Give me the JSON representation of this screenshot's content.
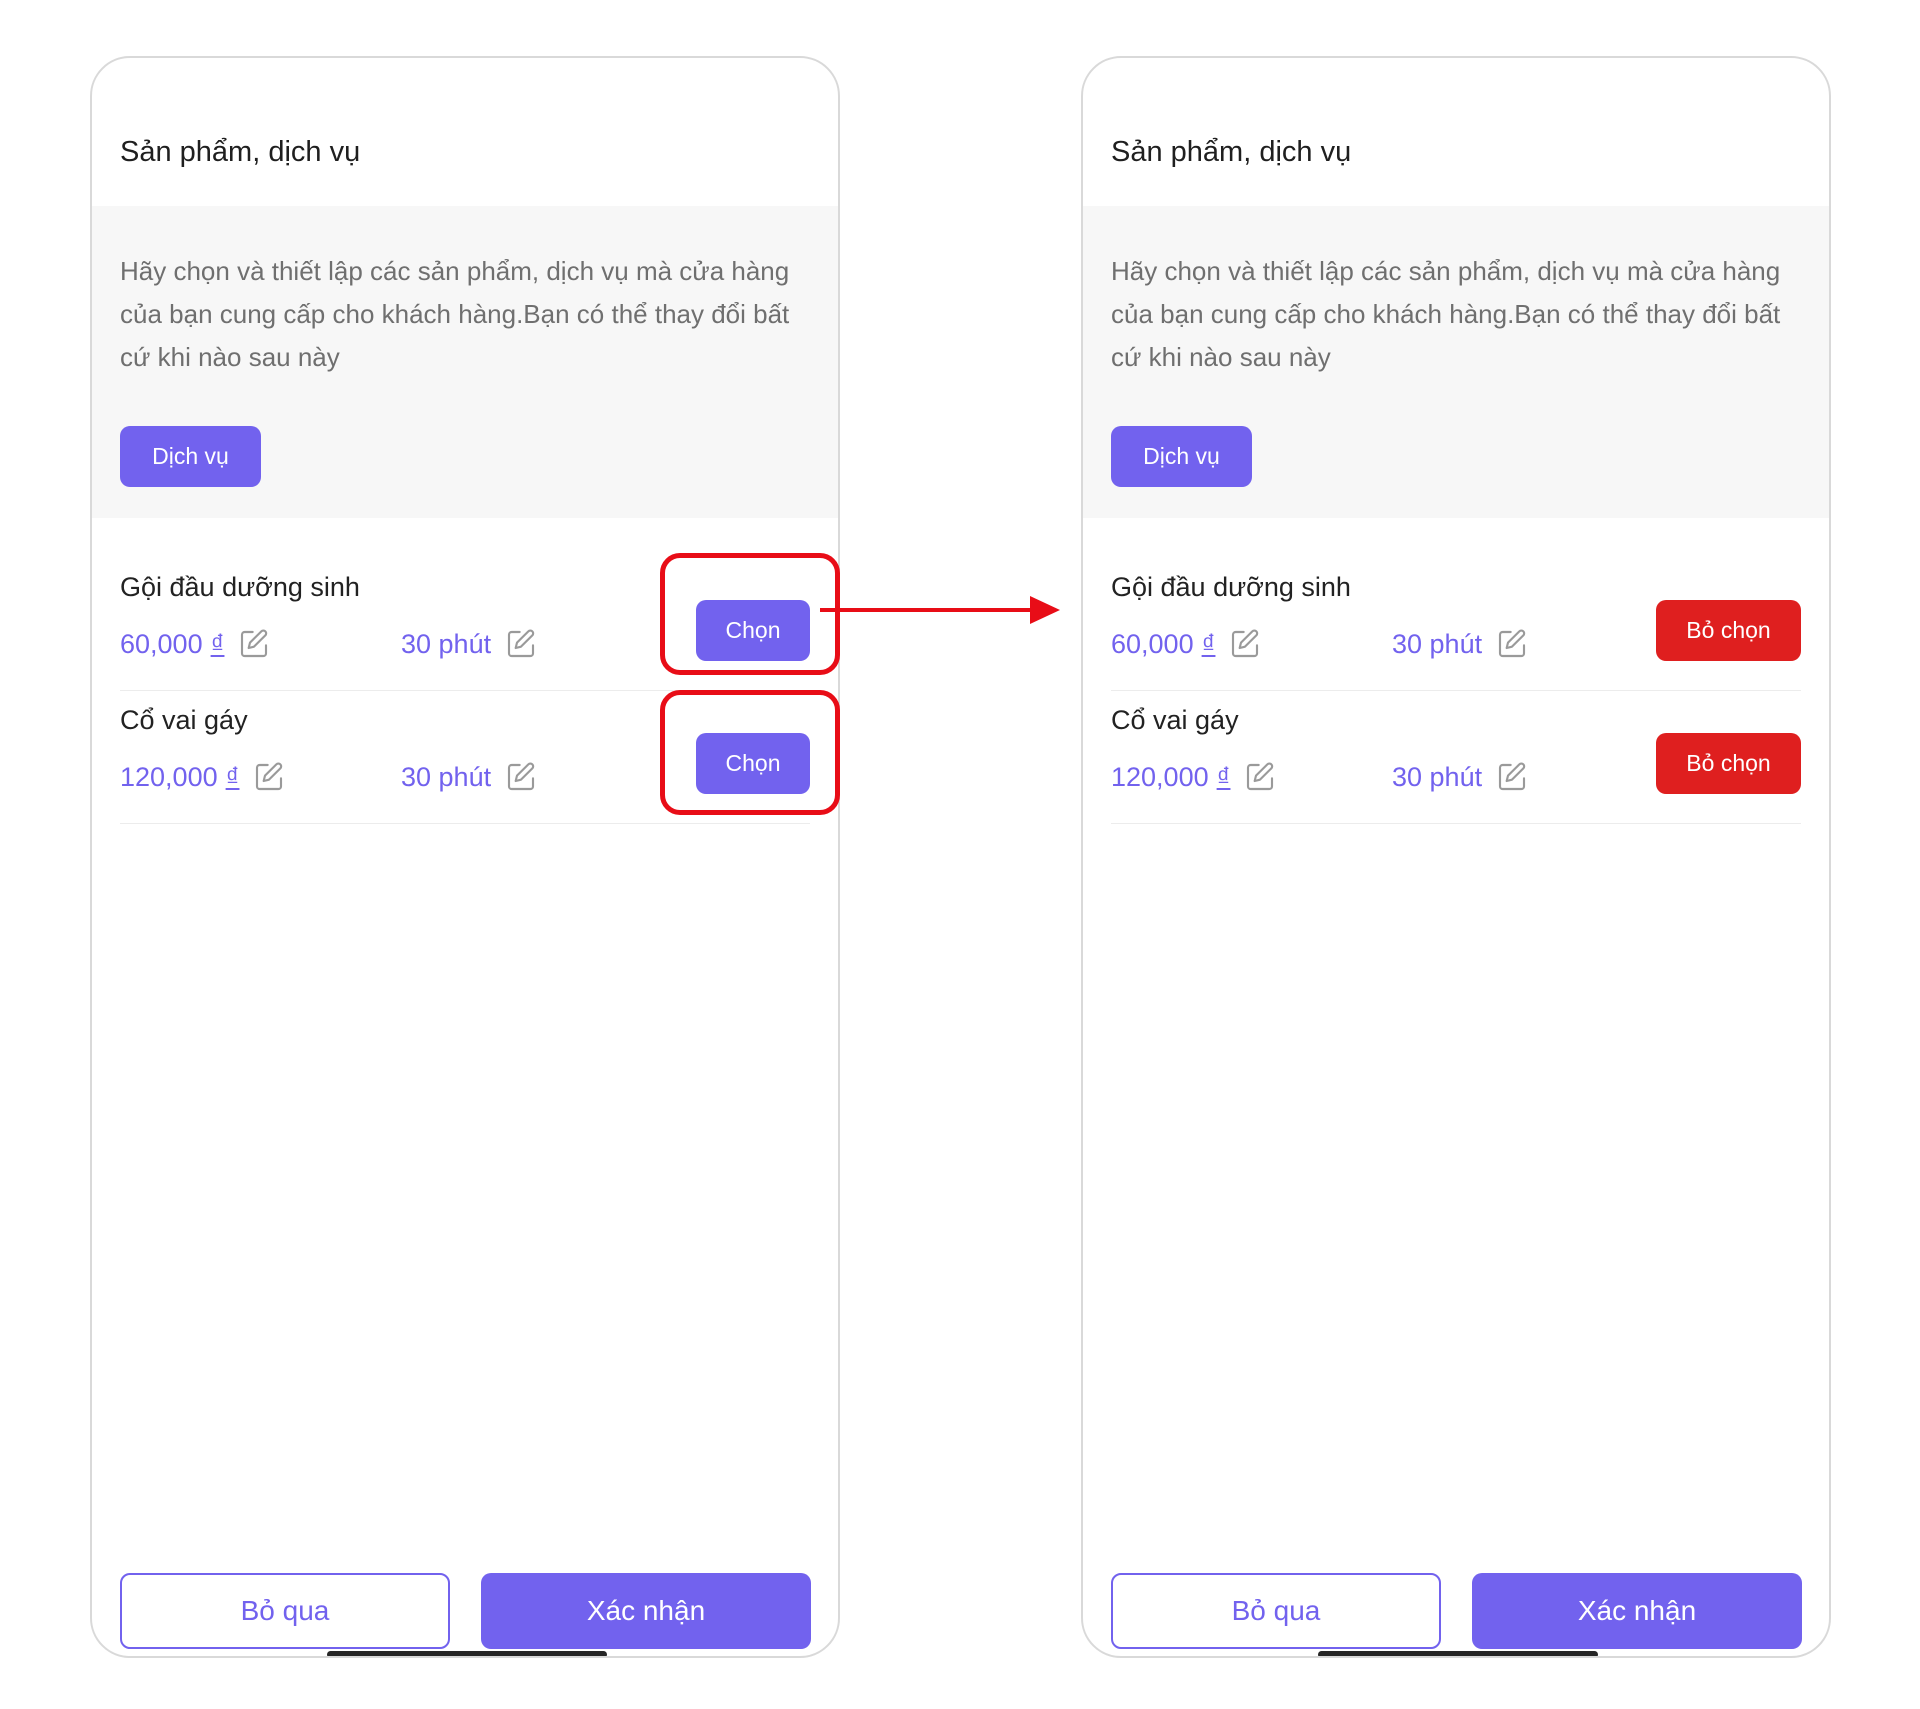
{
  "colors": {
    "accent": "#7262ee",
    "danger": "#df1f1f",
    "highlight": "#e80d17",
    "intro_background": "#f7f7f7",
    "muted_text": "#6f6f6f"
  },
  "screens": [
    {
      "title": "Sản phẩm, dịch vụ",
      "intro": "Hãy chọn và thiết lập các sản phẩm, dịch vụ mà cửa hàng của bạn cung cấp cho khách hàng.Bạn có thể thay đổi bất cứ khi nào sau này",
      "category_button": "Dịch vụ",
      "services": [
        {
          "name": "Gội đầu dưỡng sinh",
          "price": "60,000",
          "currency": "₫",
          "duration": "30 phút",
          "action": "Chọn",
          "selected": false,
          "price_edit_icon": "edit-icon",
          "duration_edit_icon": "edit-icon"
        },
        {
          "name": "Cổ vai gáy",
          "price": "120,000",
          "currency": "₫",
          "duration": "30 phút",
          "action": "Chọn",
          "selected": false,
          "price_edit_icon": "edit-icon",
          "duration_edit_icon": "edit-icon"
        }
      ],
      "footer": {
        "skip": "Bỏ qua",
        "confirm": "Xác nhận"
      }
    },
    {
      "title": "Sản phẩm, dịch vụ",
      "intro": "Hãy chọn và thiết lập các sản phẩm, dịch vụ mà cửa hàng của bạn cung cấp cho khách hàng.Bạn có thể thay đổi bất cứ khi nào sau này",
      "category_button": "Dịch vụ",
      "services": [
        {
          "name": "Gội đầu dưỡng sinh",
          "price": "60,000",
          "currency": "₫",
          "duration": "30 phút",
          "action": "Bỏ chọn",
          "selected": true,
          "price_edit_icon": "edit-icon",
          "duration_edit_icon": "edit-icon"
        },
        {
          "name": "Cổ vai gáy",
          "price": "120,000",
          "currency": "₫",
          "duration": "30 phút",
          "action": "Bỏ chọn",
          "selected": true,
          "price_edit_icon": "edit-icon",
          "duration_edit_icon": "edit-icon"
        }
      ],
      "footer": {
        "skip": "Bỏ qua",
        "confirm": "Xác nhận"
      }
    }
  ]
}
